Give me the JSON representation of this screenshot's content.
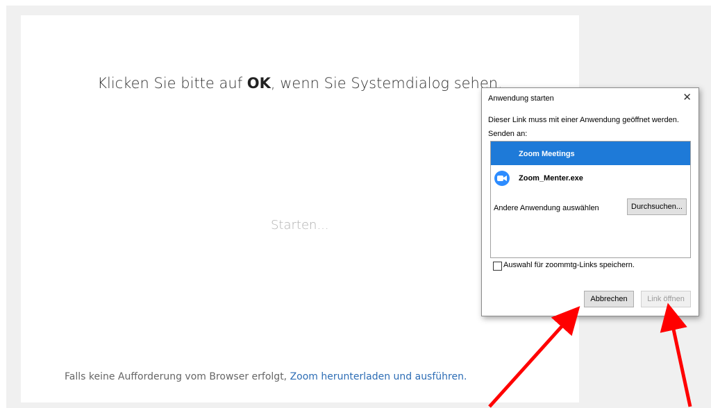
{
  "page": {
    "headline_prefix": "Klicken Sie bitte auf ",
    "headline_bold": "OK",
    "headline_suffix": ", wenn Sie Systemdialog sehen.",
    "status": "Starten...",
    "footer_text": "Falls keine Aufforderung vom Browser erfolgt, ",
    "footer_link": "Zoom herunterladen und ausführen."
  },
  "dialog": {
    "title": "Anwendung starten",
    "close_glyph": "✕",
    "message": "Dieser Link muss mit einer Anwendung geöffnet werden.",
    "send_label": "Senden an:",
    "apps": [
      {
        "label": "Zoom Meetings",
        "selected": true
      },
      {
        "label": "Zoom_Menter.exe",
        "selected": false
      }
    ],
    "other_app_label": "Andere Anwendung auswählen",
    "browse_label": "Durchsuchen...",
    "checkbox_label": "Auswahl für zoommtg-Links speichern.",
    "checkbox_checked": false,
    "cancel_label": "Abbrechen",
    "open_label": "Link öffnen",
    "open_enabled": false
  },
  "colors": {
    "selection": "#1e7ad8",
    "link": "#2d6db5",
    "annotation_arrow": "#ff0000",
    "zoom_brand": "#2d8cff"
  },
  "icons": {
    "zoom_app": "zoom-video-icon",
    "close": "close-icon"
  }
}
